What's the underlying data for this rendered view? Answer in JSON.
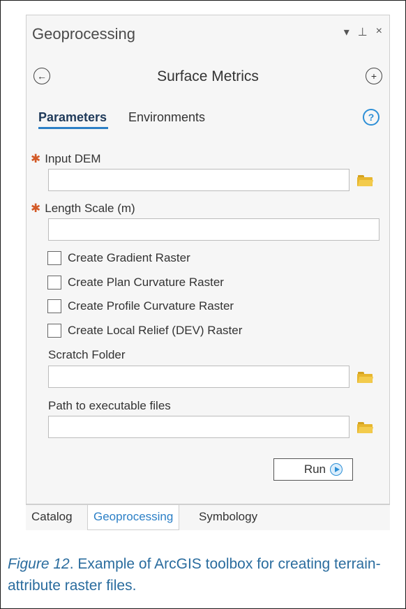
{
  "pane": {
    "title": "Geoprocessing",
    "controls": [
      "▾",
      "⊥",
      "×"
    ]
  },
  "tool": {
    "title": "Surface Metrics",
    "back_glyph": "←",
    "add_glyph": "+"
  },
  "tabs": {
    "parameters": "Parameters",
    "environments": "Environments",
    "help_glyph": "?"
  },
  "params": {
    "input_dem": {
      "label": "Input DEM",
      "value": "",
      "required": true
    },
    "length_scale": {
      "label": "Length Scale (m)",
      "value": "",
      "required": true
    },
    "checkboxes": [
      {
        "label": "Create Gradient Raster",
        "checked": false
      },
      {
        "label": "Create Plan Curvature Raster",
        "checked": false
      },
      {
        "label": "Create Profile Curvature Raster",
        "checked": false
      },
      {
        "label": "Create Local Relief (DEV) Raster",
        "checked": false
      }
    ],
    "scratch_folder": {
      "label": "Scratch Folder",
      "value": ""
    },
    "exe_path": {
      "label": "Path to executable files",
      "value": ""
    }
  },
  "run": {
    "label": "Run"
  },
  "bottom_tabs": [
    "Catalog",
    "Geoprocessing",
    "Symbology"
  ],
  "active_bottom_tab": "Geoprocessing",
  "caption": {
    "figure": "Figure 12",
    "text": ". Example of ArcGIS toolbox for creating terrain-attribute raster files."
  },
  "colors": {
    "accent": "#2b7fc6",
    "required": "#d35a27",
    "folder": "#e7b62e",
    "caption": "#2a6c9e"
  }
}
